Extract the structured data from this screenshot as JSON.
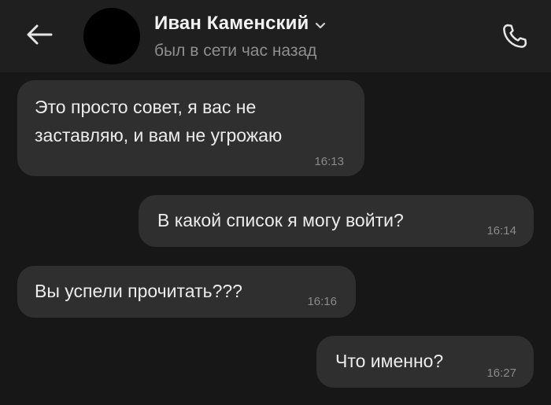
{
  "header": {
    "contact_name": "Иван Каменский",
    "status": "был в сети час назад",
    "icons": {
      "back": "arrow-left-icon",
      "expand": "chevron-down-icon",
      "call": "phone-icon"
    }
  },
  "messages": [
    {
      "direction": "incoming",
      "text": "Это просто совет, я вас не заставляю, и вам не угрожаю",
      "time": "16:13"
    },
    {
      "direction": "outgoing",
      "text": "В какой список я могу войти?",
      "time": "16:14"
    },
    {
      "direction": "incoming",
      "text": "Вы успели прочитать???",
      "time": "16:16"
    },
    {
      "direction": "outgoing",
      "text": "Что именно?",
      "time": "16:27"
    }
  ],
  "colors": {
    "background": "#171717",
    "header": "#1f1f1f",
    "bubble": "#2f2f2f",
    "text": "#ececec",
    "secondary_text": "#8e8e8e"
  }
}
